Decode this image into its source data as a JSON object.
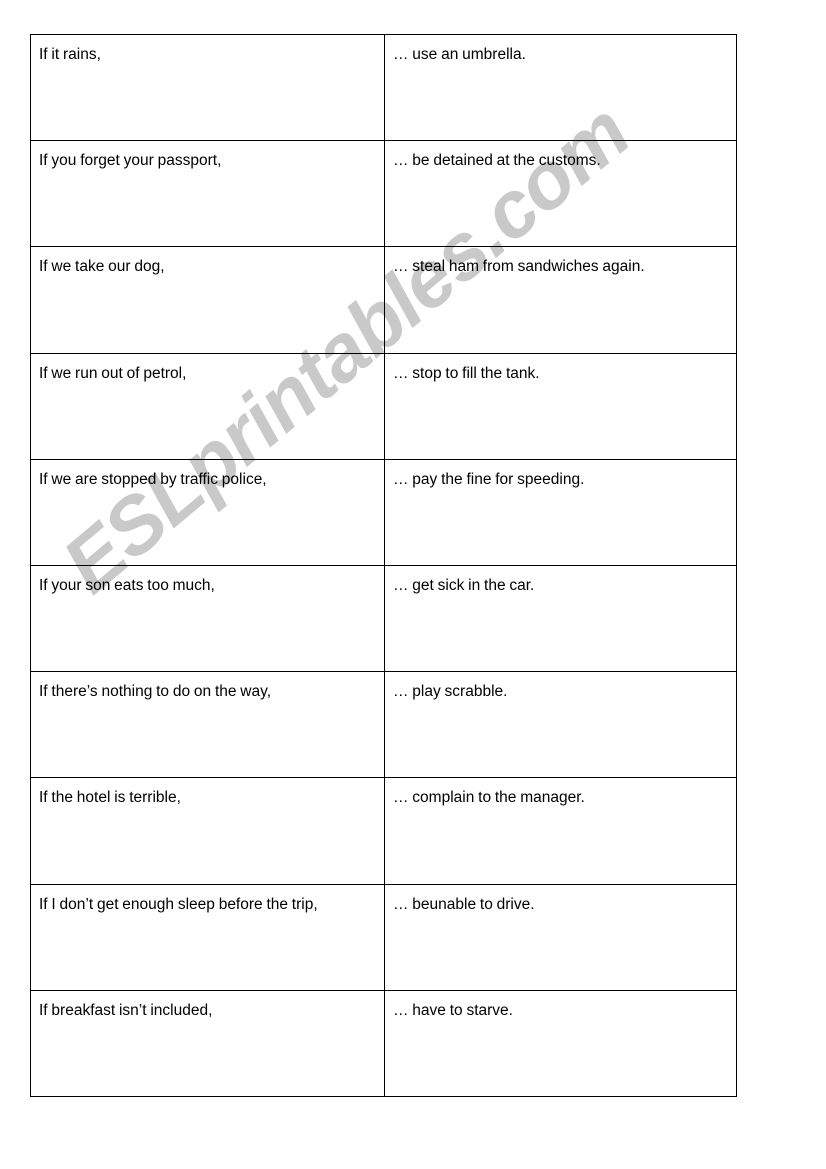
{
  "document": {
    "type": "matching-worksheet",
    "watermark": {
      "text": "ESLprintables.com",
      "color": "#c9c9c9",
      "rotation_deg": -40
    },
    "table": {
      "column_count": 2,
      "row_count": 10,
      "border_color": "#000000",
      "background": "#ffffff",
      "rows": [
        {
          "clause": "If it rains,",
          "result": "… use an umbrella."
        },
        {
          "clause": "If you forget your passport,",
          "result": "… be detained at the customs."
        },
        {
          "clause": "If we take our dog,",
          "result": "… steal ham from sandwiches again."
        },
        {
          "clause": "If we run out of petrol,",
          "result": "… stop to fill the tank."
        },
        {
          "clause": "If we are stopped by traffic police,",
          "result": "… pay the fine for speeding."
        },
        {
          "clause": "If your son eats too much,",
          "result": "… get sick in the car."
        },
        {
          "clause": "If there’s nothing to do on the way,",
          "result": "… play scrabble."
        },
        {
          "clause": "If the hotel is terrible,",
          "result": "… complain to the manager."
        },
        {
          "clause": "If I don’t get enough sleep before the trip,",
          "result": "… beunable to drive."
        },
        {
          "clause": "If breakfast isn’t included,",
          "result": "… have to starve."
        }
      ]
    }
  }
}
